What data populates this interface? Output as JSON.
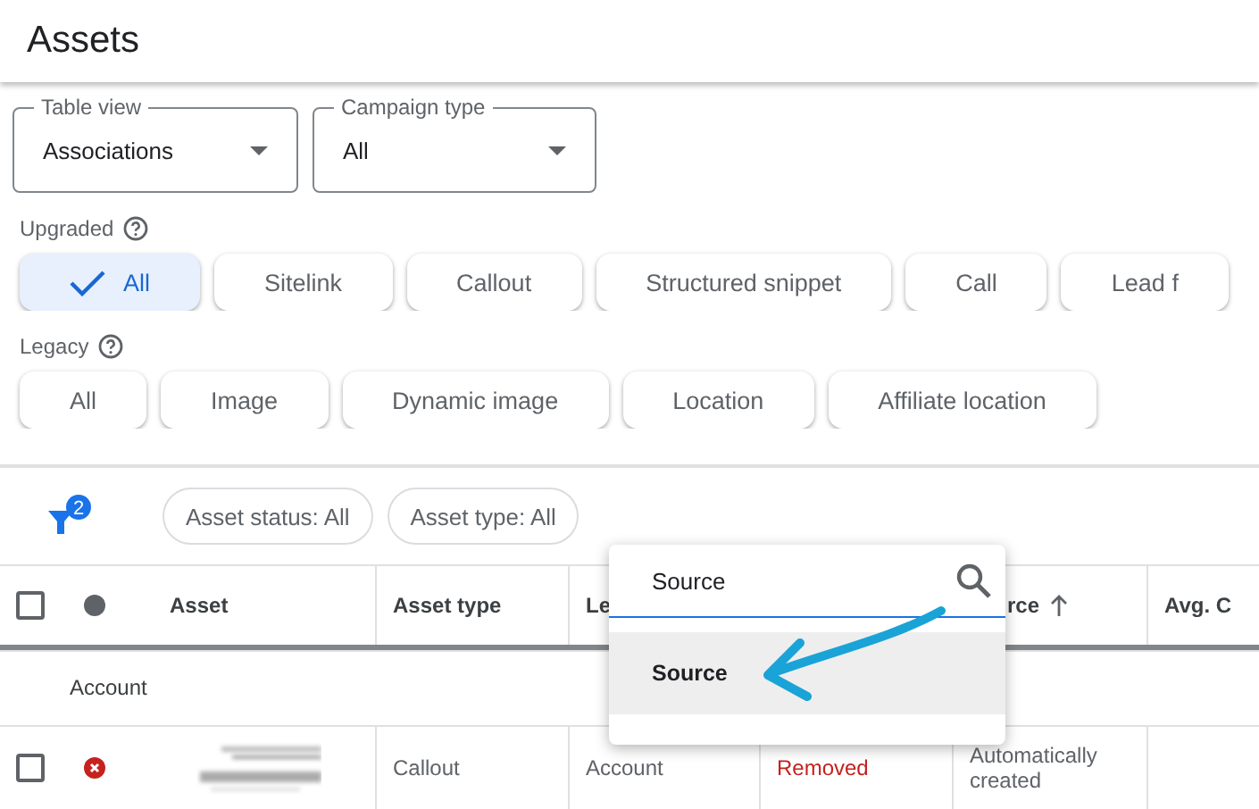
{
  "page_title": "Assets",
  "dropdowns": [
    {
      "label": "Table view",
      "value": "Associations"
    },
    {
      "label": "Campaign type",
      "value": "All"
    }
  ],
  "chip_groups": [
    {
      "label": "Upgraded",
      "chips": [
        {
          "label": "All",
          "selected": true
        },
        {
          "label": "Sitelink",
          "selected": false
        },
        {
          "label": "Callout",
          "selected": false
        },
        {
          "label": "Structured snippet",
          "selected": false
        },
        {
          "label": "Call",
          "selected": false
        },
        {
          "label": "Lead f",
          "selected": false
        }
      ]
    },
    {
      "label": "Legacy",
      "chips": [
        {
          "label": "All",
          "selected": false
        },
        {
          "label": "Image",
          "selected": false
        },
        {
          "label": "Dynamic image",
          "selected": false
        },
        {
          "label": "Location",
          "selected": false
        },
        {
          "label": "Affiliate location",
          "selected": false
        }
      ]
    }
  ],
  "filter": {
    "badge": "2",
    "chips": [
      "Asset status: All",
      "Asset type: All"
    ]
  },
  "table": {
    "header_checked": false,
    "columns": [
      {
        "label": "Asset"
      },
      {
        "label": "Asset type"
      },
      {
        "label": "Le"
      },
      {},
      {
        "label": "rce",
        "sorted": true
      },
      {
        "label": "Avg. C"
      }
    ],
    "group": "Account",
    "rows": [
      {
        "checked": false,
        "color": "#c5221f",
        "cells": [
          {
            "kind": "picture"
          },
          "Callout",
          "Account",
          "Removed",
          "Automatically created"
        ]
      }
    ]
  },
  "column_menu": {
    "search_value": "Source",
    "options": [
      {
        "label": "Source",
        "selected": true
      }
    ]
  }
}
